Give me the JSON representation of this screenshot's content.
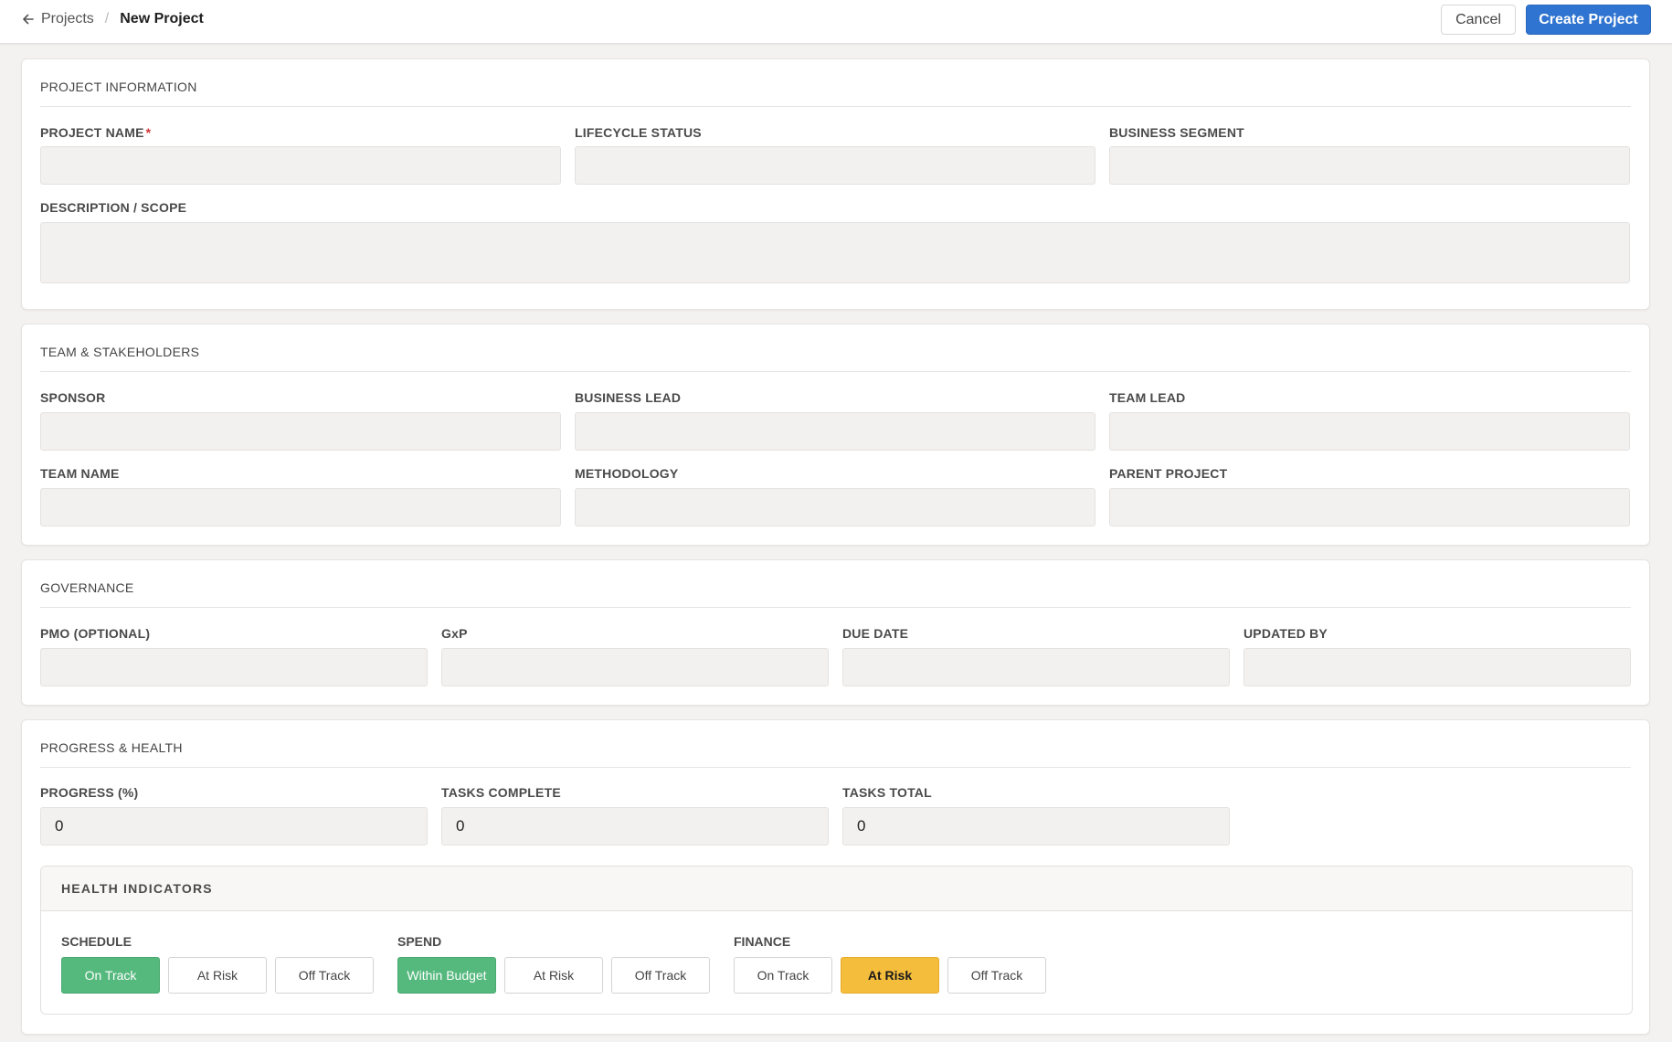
{
  "header": {
    "breadcrumb_back": "Projects",
    "breadcrumb_current": "New Project",
    "cancel_label": "Cancel",
    "create_label": "Create Project"
  },
  "project_info": {
    "title": "PROJECT INFORMATION",
    "project_name_label": "PROJECT NAME",
    "required_mark": "*",
    "lifecycle_label": "LIFECYCLE STATUS",
    "segment_label": "BUSINESS SEGMENT",
    "description_label": "DESCRIPTION / SCOPE"
  },
  "team": {
    "title": "TEAM & STAKEHOLDERS",
    "sponsor_label": "SPONSOR",
    "business_lead_label": "BUSINESS LEAD",
    "team_lead_label": "TEAM LEAD",
    "team_name_label": "TEAM NAME",
    "methodology_label": "METHODOLOGY",
    "parent_project_label": "PARENT PROJECT"
  },
  "governance": {
    "title": "GOVERNANCE",
    "pmo_label": "PMO (OPTIONAL)",
    "gxp_label": "GxP",
    "due_date_label": "DUE DATE",
    "updated_by_label": "UPDATED BY"
  },
  "progress": {
    "title": "PROGRESS & HEALTH",
    "progress_label": "PROGRESS (%)",
    "progress_value": "0",
    "tasks_complete_label": "TASKS COMPLETE",
    "tasks_complete_value": "0",
    "tasks_total_label": "TASKS TOTAL",
    "tasks_total_value": "0"
  },
  "health": {
    "title": "HEALTH INDICATORS",
    "schedule": {
      "label": "SCHEDULE",
      "options": [
        "On Track",
        "At Risk",
        "Off Track"
      ],
      "selected": "On Track"
    },
    "spend": {
      "label": "SPEND",
      "options": [
        "Within Budget",
        "At Risk",
        "Off Track"
      ],
      "selected": "Within Budget"
    },
    "finance": {
      "label": "FINANCE",
      "options": [
        "On Track",
        "At Risk",
        "Off Track"
      ],
      "selected": "At Risk"
    }
  },
  "colors": {
    "primary": "#2f74d0",
    "green_selected": "#55b97e",
    "amber_selected": "#f5bd3c",
    "required": "#d13438"
  },
  "icons": {
    "back": "arrow-left-icon"
  }
}
